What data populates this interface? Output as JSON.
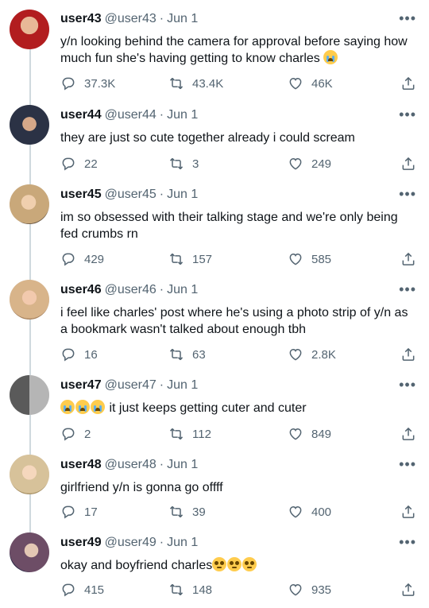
{
  "tweets": [
    {
      "name": "user43",
      "handle": "@user43",
      "date": "Jun 1",
      "text": "y/n looking behind the camera for approval before saying how much fun she's having getting to know charles",
      "emoji_after": [
        "cry"
      ],
      "emoji_before": [],
      "replies": "37.3K",
      "retweets": "43.4K",
      "likes": "46K",
      "avatar_color": "#b21d1f"
    },
    {
      "name": "user44",
      "handle": "@user44",
      "date": "Jun 1",
      "text": "they are just so cute together already i could scream",
      "emoji_after": [],
      "emoji_before": [],
      "replies": "22",
      "retweets": "3",
      "likes": "249",
      "avatar_color": "#2b3245"
    },
    {
      "name": "user45",
      "handle": "@user45",
      "date": "Jun 1",
      "text": "im so obsessed with their talking stage and we're only being fed crumbs rn",
      "emoji_after": [],
      "emoji_before": [],
      "replies": "429",
      "retweets": "157",
      "likes": "585",
      "avatar_color": "#c9a87a"
    },
    {
      "name": "user46",
      "handle": "@user46",
      "date": "Jun 1",
      "text": "i feel like charles' post where he's using a photo strip of y/n as a bookmark wasn't talked about enough tbh",
      "emoji_after": [],
      "emoji_before": [],
      "replies": "16",
      "retweets": "63",
      "likes": "2.8K",
      "avatar_color": "#d8b48a"
    },
    {
      "name": "user47",
      "handle": "@user47",
      "date": "Jun 1",
      "text": "it just keeps getting cuter and cuter",
      "emoji_after": [],
      "emoji_before": [
        "cry",
        "cry",
        "cry"
      ],
      "replies": "2",
      "retweets": "112",
      "likes": "849",
      "avatar_color": "#8a8a8a"
    },
    {
      "name": "user48",
      "handle": "@user48",
      "date": "Jun 1",
      "text": "girlfriend y/n is gonna go offff",
      "emoji_after": [],
      "emoji_before": [],
      "replies": "17",
      "retweets": "39",
      "likes": "400",
      "avatar_color": "#d7c29a"
    },
    {
      "name": "user49",
      "handle": "@user49",
      "date": "Jun 1",
      "text": "okay and boyfriend charles",
      "emoji_after": [
        "plead",
        "plead",
        "plead"
      ],
      "emoji_before": [],
      "replies": "415",
      "retweets": "148",
      "likes": "935",
      "avatar_color": "#6d4d66"
    }
  ],
  "more_glyph": "•••",
  "date_separator": "·"
}
